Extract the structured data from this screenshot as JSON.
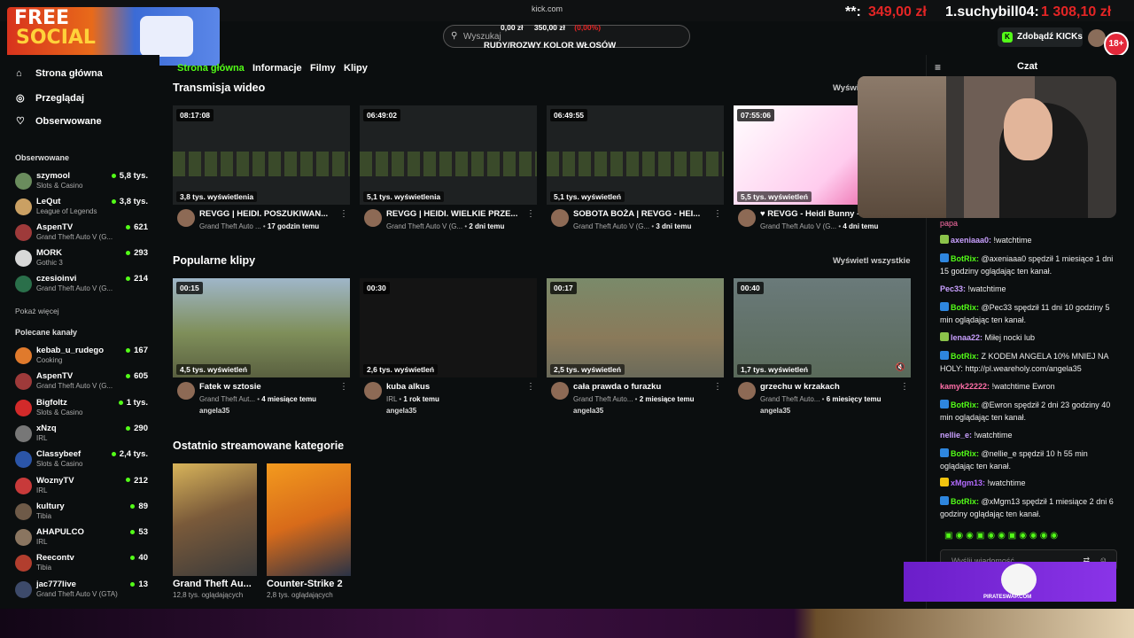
{
  "browser": {
    "url": "kick.com"
  },
  "overlay": {
    "left_prefix": "**:",
    "left_amount": "349,00 zł",
    "right_label": "1.suchybill04:",
    "right_amount": "1 308,10 zł",
    "mini_a": "0,00 zł",
    "mini_b": "350,00 zł",
    "mini_c": "(0,00%)",
    "goal_text": "RUDY/ROZWY KOLOR WŁOSÓW",
    "logo_line1": "FREE",
    "logo_line2": "SOCIAL",
    "ad_text": "PIRATESWAP.COM"
  },
  "header": {
    "search_placeholder": "Wyszukaj",
    "kicks_label": "Zdobądź KICKs",
    "age_badge": "18+"
  },
  "sidebar": {
    "nav": [
      {
        "label": "Strona główna"
      },
      {
        "label": "Przeglądaj"
      },
      {
        "label": "Obserwowane"
      }
    ],
    "following_title": "Obserwowane",
    "following": [
      {
        "name": "szymool",
        "game": "Slots & Casino",
        "viewers": "5,8 tys.",
        "color": "#6a8c5d"
      },
      {
        "name": "LeQut",
        "game": "League of Legends",
        "viewers": "3,8 tys.",
        "color": "#caa063"
      },
      {
        "name": "AspenTV",
        "game": "Grand Theft Auto V (G...",
        "viewers": "621",
        "color": "#9e3a3a"
      },
      {
        "name": "MORK",
        "game": "Gothic 3",
        "viewers": "293",
        "color": "#d8d8d8"
      },
      {
        "name": "czesioinvi",
        "game": "Grand Theft Auto V (G...",
        "viewers": "214",
        "color": "#2a6f4a"
      }
    ],
    "show_more": "Pokaż więcej",
    "recommended_title": "Polecane kanały",
    "recommended": [
      {
        "name": "kebab_u_rudego",
        "game": "Cooking",
        "viewers": "167",
        "color": "#e07a2c"
      },
      {
        "name": "AspenTV",
        "game": "Grand Theft Auto V (G...",
        "viewers": "605",
        "color": "#9e3a3a"
      },
      {
        "name": "Bigfoltz",
        "game": "Slots & Casino",
        "viewers": "1 tys.",
        "color": "#d22a2a"
      },
      {
        "name": "xNzq",
        "game": "IRL",
        "viewers": "290",
        "color": "#777"
      },
      {
        "name": "Classybeef",
        "game": "Slots & Casino",
        "viewers": "2,4 tys.",
        "color": "#2b55a8"
      },
      {
        "name": "WoznyTV",
        "game": "IRL",
        "viewers": "212",
        "color": "#c83a3a"
      },
      {
        "name": "kultury",
        "game": "Tibia",
        "viewers": "89",
        "color": "#6e5a48"
      },
      {
        "name": "AHAPULCO",
        "game": "IRL",
        "viewers": "53",
        "color": "#8a7560"
      },
      {
        "name": "Reecontv",
        "game": "Tibia",
        "viewers": "40",
        "color": "#b23e2e"
      },
      {
        "name": "jac777live",
        "game": "Grand Theft Auto V (GTA)",
        "viewers": "13",
        "color": "#3d4a6a"
      }
    ]
  },
  "tabs": [
    {
      "label": "Strona główna"
    },
    {
      "label": "Informacje"
    },
    {
      "label": "Filmy"
    },
    {
      "label": "Klipy"
    }
  ],
  "videos": {
    "title": "Transmisja wideo",
    "see_all": "Wyświetl",
    "items": [
      {
        "duration": "08:17:08",
        "views": "3,8 tys. wyświetlenia",
        "title": "REVGG | HEIDI. POSZUKIWAN...",
        "game": "Grand Theft Auto ...",
        "age": "17 godzin temu"
      },
      {
        "duration": "06:49:02",
        "views": "5,1 tys. wyświetlenia",
        "title": "REVGG | HEIDI. WIELKIE PRZE...",
        "game": "Grand Theft Auto V (G...",
        "age": "2 dni temu"
      },
      {
        "duration": "06:49:55",
        "views": "5,1 tys. wyświetleń",
        "title": "SOBOTA BOŻA | REVGG - HEI...",
        "game": "Grand Theft Auto V (G...",
        "age": "3 dni temu"
      },
      {
        "duration": "07:55:06",
        "views": "5,5 tys. wyświetleń",
        "title": "♥ REVGG - Heidi Bunny -",
        "game": "Grand Theft Auto V (G...",
        "age": "4 dni temu"
      }
    ]
  },
  "clips": {
    "title": "Popularne klipy",
    "see_all": "Wyświetl wszystkie",
    "items": [
      {
        "duration": "00:15",
        "views": "4,5 tys. wyświetleń",
        "title": "Fatek w sztosie",
        "game": "Grand Theft Aut...",
        "age": "4 miesiące temu",
        "author": "angela35"
      },
      {
        "duration": "00:30",
        "views": "2,6 tys. wyświetleń",
        "title": "kuba alkus",
        "game": "IRL",
        "age": "1 rok temu",
        "author": "angela35"
      },
      {
        "duration": "00:17",
        "views": "2,5 tys. wyświetleń",
        "title": "cała prawda o furazku",
        "game": "Grand Theft Auto...",
        "age": "2 miesiące temu",
        "author": "angela35"
      },
      {
        "duration": "00:40",
        "views": "1,7 tys. wyświetleń",
        "title": "grzechu w krzakach",
        "game": "Grand Theft Auto...",
        "age": "6 miesięcy temu",
        "author": "angela35"
      }
    ]
  },
  "categories": {
    "title": "Ostatnio streamowane kategorie",
    "items": [
      {
        "name": "Grand Theft Au...",
        "viewers": "12,8 tys. oglądających"
      },
      {
        "name": "Counter-Strike 2",
        "viewers": "2,8 tys. oglądających"
      }
    ]
  },
  "chat": {
    "title": "Czat",
    "messages": [
      {
        "user": "axeniaaa0:",
        "text": " !watchtime",
        "color": "#c9a0ff",
        "badge": "#8bc34a"
      },
      {
        "user": "BotRix:",
        "text": " @axeniaaa0 spędził 1 miesiące 1 dni 15 godziny oglądając ten kanał.",
        "color": "#53fc18",
        "badge": "#2e86de"
      },
      {
        "user": "Pec33:",
        "text": " !watchtime",
        "color": "#c9a0ff",
        "badge": ""
      },
      {
        "user": "BotRix:",
        "text": " @Pec33 spędził 11 dni 10 godziny 5 min oglądając ten kanał.",
        "color": "#53fc18",
        "badge": "#2e86de"
      },
      {
        "user": "lenaa22:",
        "text": " Miłej nocki lub",
        "color": "#c9a0ff",
        "badge": "#8bc34a"
      },
      {
        "user": "BotRix:",
        "text": " Z KODEM ANGELA 10% MNIEJ NA HOLY: http://pl.weareholy.com/angela35",
        "color": "#53fc18",
        "badge": "#2e86de"
      },
      {
        "user": "kamyk22222:",
        "text": " !watchtime Ewron",
        "color": "#ff6fa8",
        "badge": ""
      },
      {
        "user": "BotRix:",
        "text": " @Ewron spędził 2 dni 23 godziny 40 min oglądając ten kanał.",
        "color": "#53fc18",
        "badge": "#2e86de"
      },
      {
        "user": "nellie_e:",
        "text": " !watchtime",
        "color": "#c9a0ff",
        "badge": ""
      },
      {
        "user": "BotRix:",
        "text": " @nellie_e spędził 10 h 55 min oglądając ten kanał.",
        "color": "#53fc18",
        "badge": "#2e86de"
      },
      {
        "user": "xMgm13:",
        "text": " !watchtime",
        "color": "#b36bff",
        "badge": "#f1c40f"
      },
      {
        "user": "BotRix:",
        "text": " @xMgm13 spędził 1 miesiące 2 dni 6 godziny oglądając ten kanał.",
        "color": "#53fc18",
        "badge": "#2e86de"
      }
    ],
    "partial_top": "papa",
    "input_placeholder": "Wyślij wiadomość"
  }
}
